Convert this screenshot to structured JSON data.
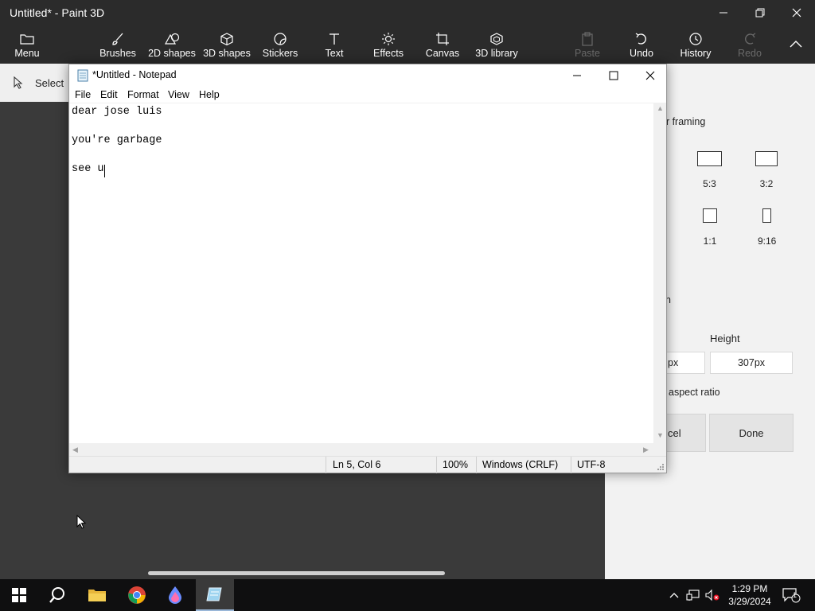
{
  "paint3d": {
    "title": "Untitled* - Paint 3D",
    "menu_label": "Menu",
    "ribbon": [
      {
        "label": "Brushes",
        "icon": "brush-icon"
      },
      {
        "label": "2D shapes",
        "icon": "2d-shapes-icon"
      },
      {
        "label": "3D shapes",
        "icon": "3d-cube-icon"
      },
      {
        "label": "Stickers",
        "icon": "sticker-icon"
      },
      {
        "label": "Text",
        "icon": "text-t-icon"
      },
      {
        "label": "Effects",
        "icon": "sun-effects-icon"
      },
      {
        "label": "Canvas",
        "icon": "canvas-crop-icon"
      },
      {
        "label": "3D library",
        "icon": "3d-library-icon"
      }
    ],
    "paste_label": "Paste",
    "undo_label": "Undo",
    "history_label": "History",
    "redo_label": "Redo",
    "select_label": "Select",
    "panel": {
      "framing_text": "ur framing",
      "ratios": [
        "5:3",
        "3:2",
        "1:1",
        "9:16"
      ],
      "stray_letter": "n",
      "height_label": "Height",
      "width_value": "px",
      "height_value": "307px",
      "aspect_text": "aspect ratio",
      "cancel_label": "cel",
      "done_label": "Done"
    }
  },
  "notepad": {
    "title": "*Untitled - Notepad",
    "menus": [
      "File",
      "Edit",
      "Format",
      "View",
      "Help"
    ],
    "lines": [
      "dear jose luis",
      "",
      "you're garbage",
      "",
      "see u"
    ],
    "status": {
      "position": "Ln 5, Col 6",
      "zoom": "100%",
      "line_ending": "Windows (CRLF)",
      "encoding": "UTF-8"
    }
  },
  "taskbar": {
    "apps": [
      "start-icon",
      "search-icon",
      "file-explorer-icon",
      "chrome-icon",
      "paint3d-icon",
      "notepad-icon"
    ],
    "time": "1:29 PM",
    "date": "3/29/2024",
    "notification_count": "1"
  }
}
